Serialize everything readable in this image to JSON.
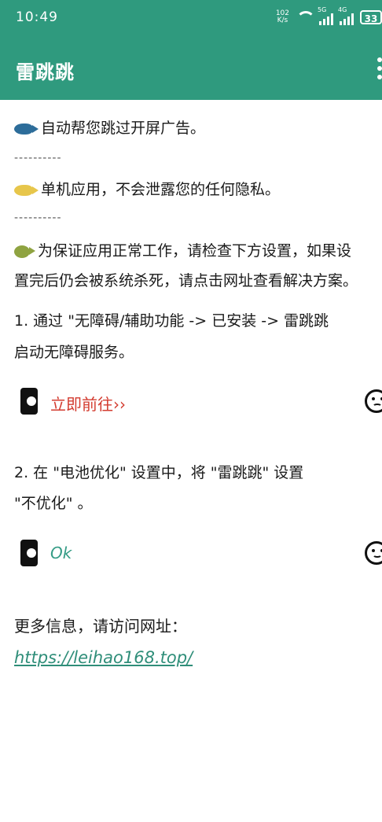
{
  "status_bar": {
    "time": "10:49",
    "speed_value": "102",
    "speed_unit": "K/s",
    "signal1": "5G",
    "signal2": "4G",
    "battery": "33"
  },
  "app_bar": {
    "title": "雷跳跳",
    "menu_icon": "more-vert-icon"
  },
  "content": {
    "feature1": "自动帮您跳过开屏广告。",
    "separator1": "----------",
    "feature2": "单机应用，不会泄露您的任何隐私。",
    "separator2": "----------",
    "notice_line1": "为保证应用正常工作，请检查下方设置，如果设",
    "notice_line2": "置完后仍会被系统杀死，请点击网址查看解决方案。",
    "step1_line1": "1. 通过 \"无障碍/辅助功能 -> 已安装 -> 雷跳跳",
    "step1_line2": "启动无障碍服务。",
    "step1_action": "立即前往››",
    "step2_line1": "2. 在 \"电池优化\" 设置中，将 \"雷跳跳\" 设置",
    "step2_line2": "\"不优化\" 。",
    "step2_action": "Ok",
    "more_info": "更多信息，请访问网址：",
    "url": "https://leihao168.top/"
  },
  "colors": {
    "accent": "#2f9a7e",
    "action_red": "#d33b2f",
    "action_teal": "#359c86"
  }
}
